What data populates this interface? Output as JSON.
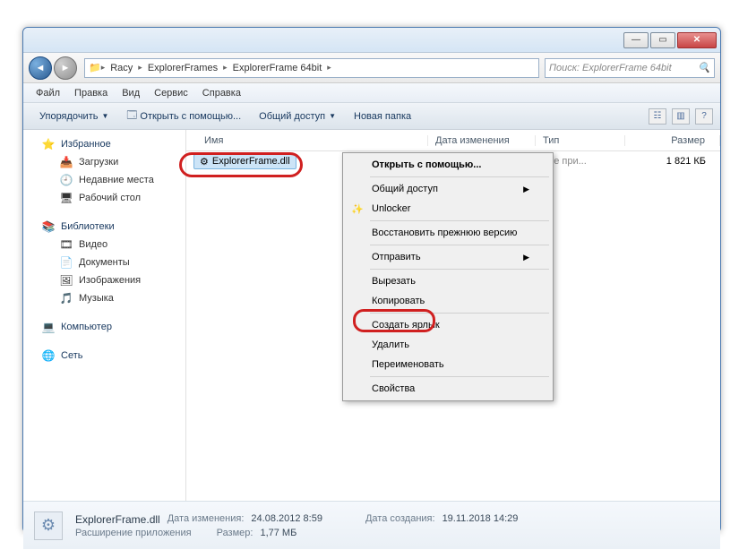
{
  "titlebar": {},
  "nav": {
    "breadcrumb": [
      "Racy",
      "ExplorerFrames",
      "ExplorerFrame 64bit"
    ],
    "search_placeholder": "Поиск: ExplorerFrame 64bit"
  },
  "menubar": [
    "Файл",
    "Правка",
    "Вид",
    "Сервис",
    "Справка"
  ],
  "toolbar": {
    "organize": "Упорядочить",
    "open_with": "Открыть с помощью...",
    "share": "Общий доступ",
    "new_folder": "Новая папка"
  },
  "columns": {
    "name": "Имя",
    "date": "Дата изменения",
    "type": "Тип",
    "size": "Размер"
  },
  "file": {
    "name": "ExplorerFrame.dll",
    "type_partial": "ние при...",
    "size": "1 821 КБ"
  },
  "sidebar": {
    "favorites": {
      "title": "Избранное",
      "items": [
        "Загрузки",
        "Недавние места",
        "Рабочий стол"
      ]
    },
    "libraries": {
      "title": "Библиотеки",
      "items": [
        "Видео",
        "Документы",
        "Изображения",
        "Музыка"
      ]
    },
    "computer": "Компьютер",
    "network": "Сеть"
  },
  "context_menu": {
    "open_with": "Открыть с помощью...",
    "share": "Общий доступ",
    "unlocker": "Unlocker",
    "restore": "Восстановить прежнюю версию",
    "send_to": "Отправить",
    "cut": "Вырезать",
    "copy": "Копировать",
    "shortcut": "Создать ярлык",
    "delete": "Удалить",
    "rename": "Переименовать",
    "properties": "Свойства"
  },
  "status": {
    "filename": "ExplorerFrame.dll",
    "desc": "Расширение приложения",
    "mod_lbl": "Дата изменения:",
    "mod_val": "24.08.2012 8:59",
    "size_lbl": "Размер:",
    "size_val": "1,77 МБ",
    "create_lbl": "Дата создания:",
    "create_val": "19.11.2018 14:29"
  }
}
